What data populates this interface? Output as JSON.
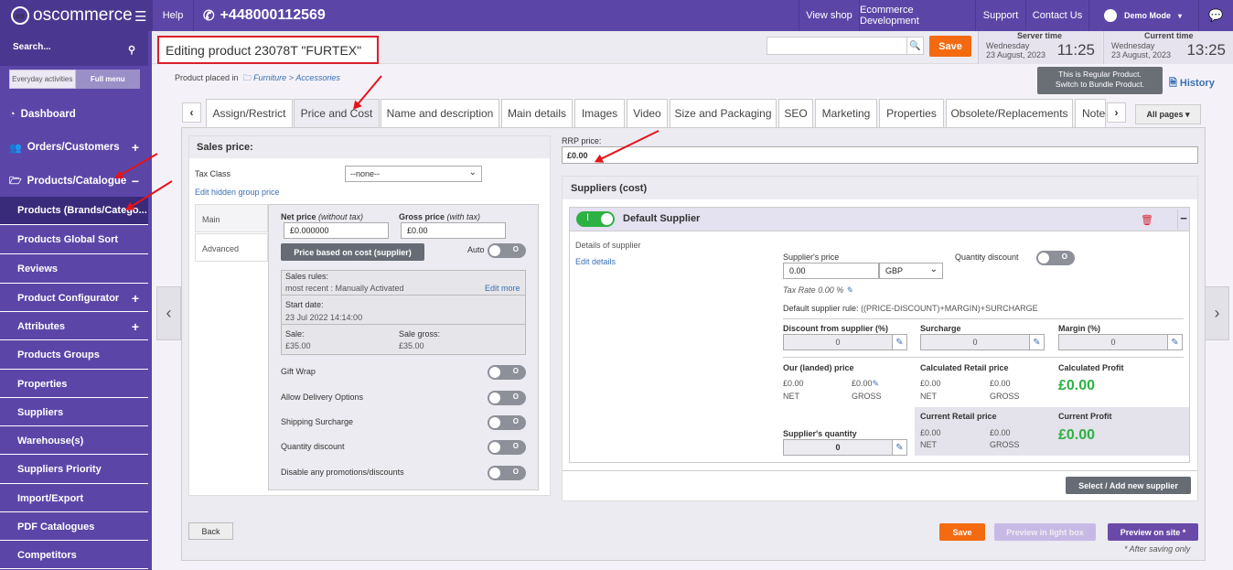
{
  "topbar": {
    "logo_text": "oscommerce",
    "help": "Help",
    "phone": "+448000112569",
    "links": [
      "View shop",
      "Ecommerce Development",
      "Support",
      "Contact Us"
    ],
    "user": "Demo Mode"
  },
  "sidebar": {
    "search_label": "Search...",
    "tab_everyday": "Everyday activities",
    "tab_full": "Full menu",
    "dashboard": "Dashboard",
    "orders": "Orders/Customers",
    "products": "Products/Catalogue",
    "items": [
      "Products (Brands/Catego...",
      "Products Global Sort",
      "Reviews",
      "Product Configurator",
      "Attributes",
      "Products Groups",
      "Properties",
      "Suppliers",
      "Warehouse(s)",
      "Suppliers Priority",
      "Import/Export",
      "PDF Catalogues",
      "Competitors"
    ]
  },
  "header": {
    "title": "Editing product 23078T \"FURTEX\"",
    "save": "Save",
    "server_time_label": "Server time",
    "server_day": "Wednesday",
    "server_date": "23 August, 2023",
    "server_clock": "11:25",
    "current_time_label": "Current time",
    "current_day": "Wednesday",
    "current_date": "23 August, 2023",
    "current_clock": "13:25",
    "placed_label": "Product placed in",
    "placed_cat1": "Furniture",
    "placed_sep": ">",
    "placed_cat2": "Accessories",
    "regular_line1": "This is Regular Product.",
    "regular_line2": "Switch to Bundle Product.",
    "history": "History"
  },
  "tabs": [
    "Assign/Restrict",
    "Price and Cost",
    "Name and description",
    "Main details",
    "Images",
    "Video",
    "Size and Packaging",
    "SEO",
    "Marketing",
    "Properties",
    "Obsolete/Replacements",
    "Note"
  ],
  "all_pages": "All pages",
  "sales": {
    "title": "Sales price:",
    "tax_class_label": "Tax Class",
    "tax_class_value": "--none--",
    "edit_hidden": "Edit hidden group price",
    "tab_main": "Main",
    "tab_advanced": "Advanced",
    "net_label": "Net price",
    "net_sub": "(without tax)",
    "net_value": "£0.000000",
    "gross_label": "Gross price",
    "gross_sub": "(with tax)",
    "gross_value": "£0.00",
    "price_cost_btn": "Price based on cost (supplier)",
    "auto": "Auto",
    "toggle_off": "O",
    "rules_title": "Sales rules:",
    "rules_recent": "most recent : Manually Activated",
    "rules_edit": "Edit more",
    "start_label": "Start date:",
    "start_value": "23 Jul 2022 14:14:00",
    "sale_label": "Sale:",
    "sale_value": "£35.00",
    "salegross_label": "Sale gross:",
    "salegross_value": "£35.00",
    "options": [
      "Gift Wrap",
      "Allow Delivery Options",
      "Shipping Surcharge",
      "Quantity discount",
      "Disable any promotions/discounts"
    ],
    "back": "Back"
  },
  "rrp": {
    "label": "RRP price:",
    "value": "£0.00"
  },
  "suppliers": {
    "title": "Suppliers (cost)",
    "default": "Default Supplier",
    "toggle_on": "I",
    "details": "Details of supplier",
    "edit_details": "Edit details",
    "price_label": "Supplier's price",
    "price_value": "0.00",
    "currency": "GBP",
    "qty_discount": "Quantity discount",
    "tax_rate": "Tax Rate 0.00 %",
    "rule_label": "Default supplier rule:",
    "rule_value": "((PRICE-DISCOUNT)+MARGIN)+SURCHARGE",
    "discount_label": "Discount from supplier (%)",
    "discount_value": "0",
    "surcharge_label": "Surcharge",
    "surcharge_value": "0",
    "margin_label": "Margin (%)",
    "margin_value": "0",
    "landed_label": "Our (landed) price",
    "landed_net": "£0.00",
    "landed_gross": "£0.00",
    "net": "NET",
    "gross": "GROSS",
    "calc_retail_label": "Calculated Retail price",
    "calc_retail_net": "£0.00",
    "calc_retail_gross": "£0.00",
    "calc_profit_label": "Calculated Profit",
    "calc_profit": "£0.00",
    "qty_label": "Supplier's quantity",
    "qty_value": "0",
    "cur_retail_label": "Current Retail price",
    "cur_retail_net": "£0.00",
    "cur_retail_gross": "£0.00",
    "cur_profit_label": "Current Profit",
    "cur_profit": "£0.00",
    "select_new": "Select / Add new supplier"
  },
  "footer": {
    "save": "Save",
    "preview_lightbox": "Preview in light box",
    "preview_site": "Preview on site *",
    "after_saving": "* After saving only"
  },
  "colors": {
    "accent": "#5b46a8",
    "save": "#f36a10",
    "green": "#2db143",
    "annotation": "#e3141b"
  }
}
